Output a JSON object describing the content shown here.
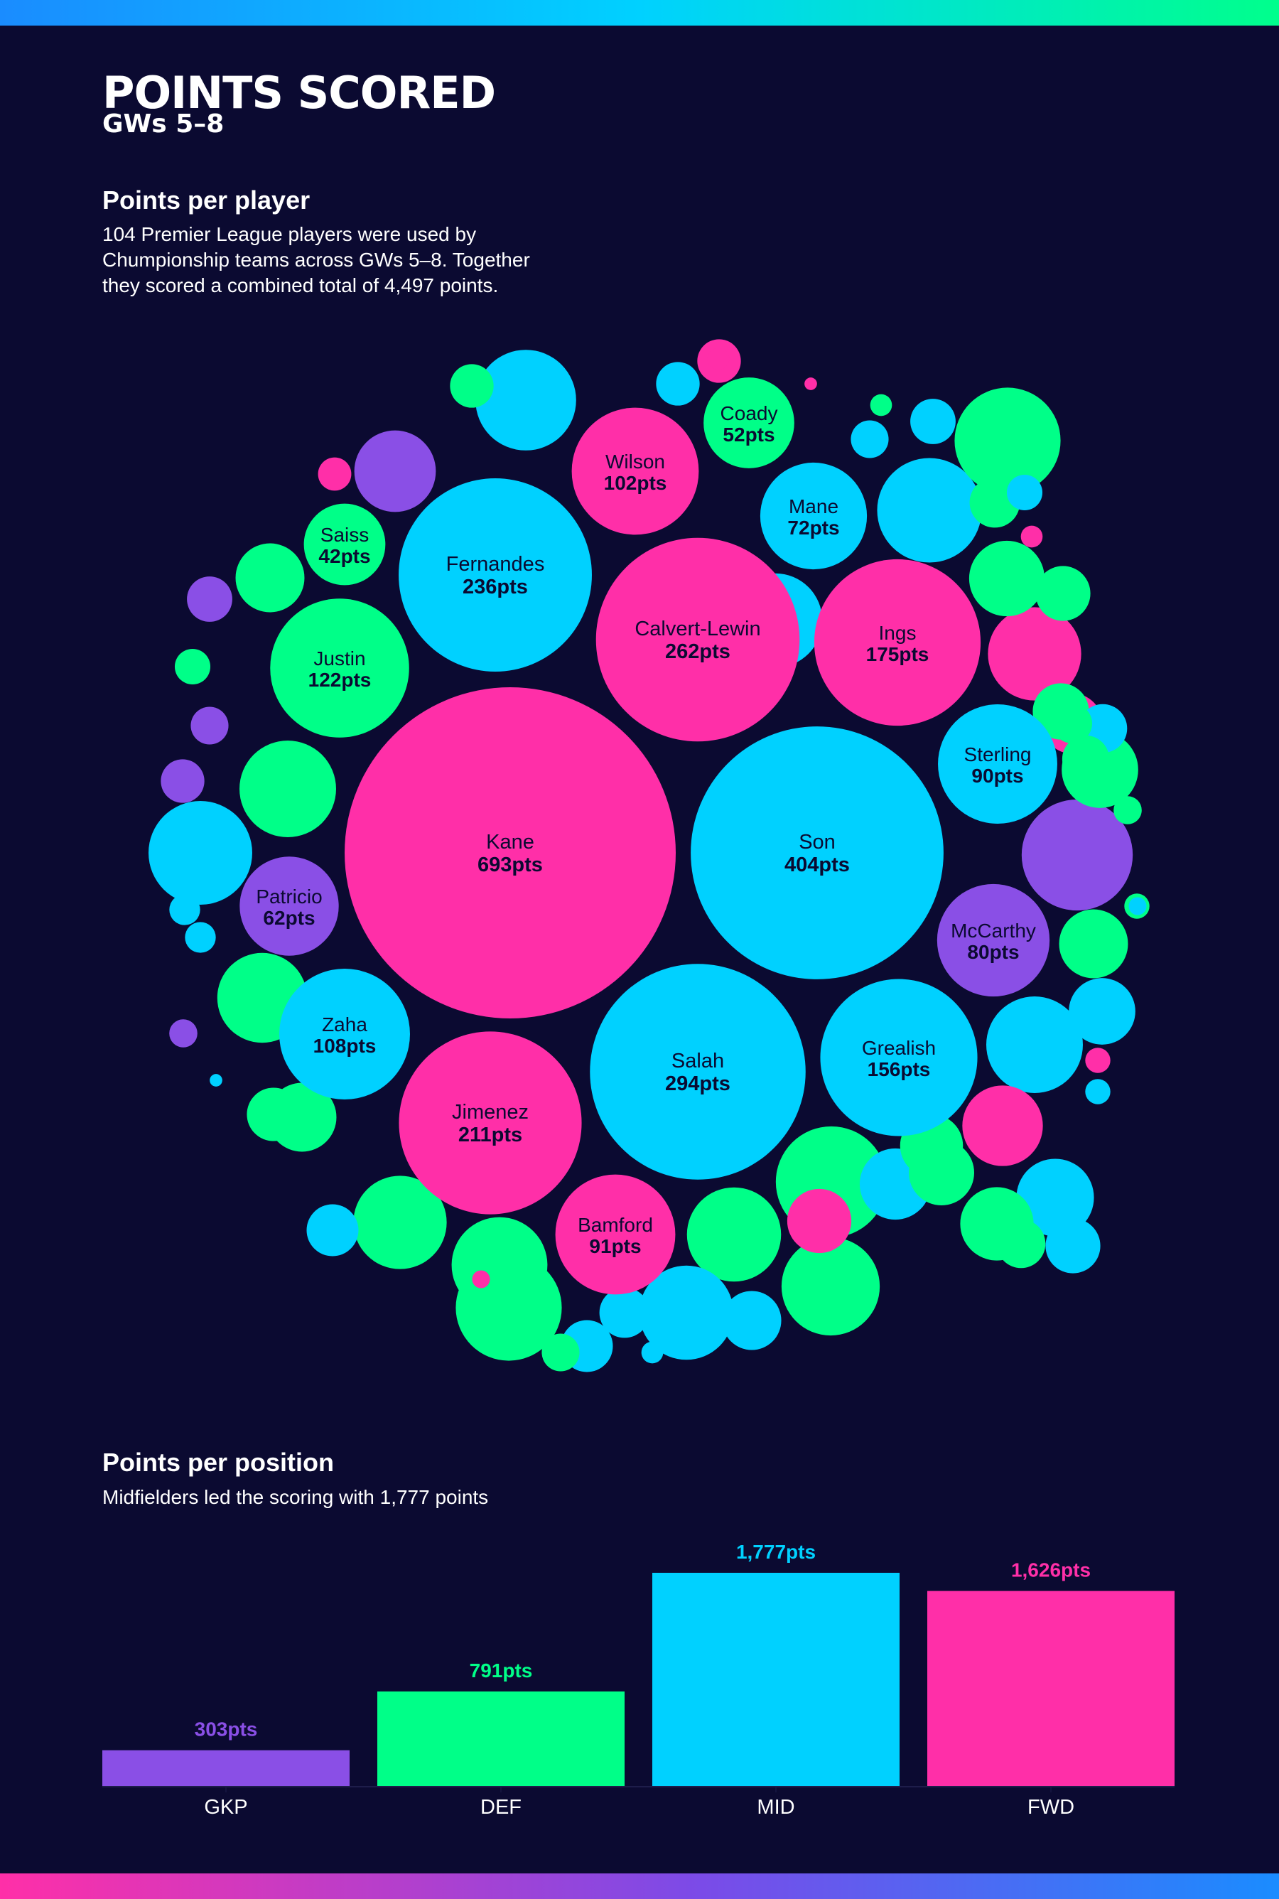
{
  "header": {
    "title": "POINTS SCORED",
    "subtitle": "GWs 5–8"
  },
  "players_section": {
    "heading": "Points per player",
    "description": "104 Premier League players were used by Chumpionship teams across GWs 5–8. Together they scored a combined total of 4,497 points."
  },
  "position_section": {
    "heading": "Points per position",
    "description": "Midfielders led the scoring with 1,777 points"
  },
  "colors": {
    "background": "#0b0a31",
    "GKP": "#8a4fe6",
    "DEF": "#00ff88",
    "MID": "#00d1ff",
    "FWD": "#ff2fa8",
    "bubble_text": "#0b0a31"
  },
  "chart_data": [
    {
      "type": "bubble",
      "title": "Points per player",
      "labeled_players": [
        {
          "name": "Kane",
          "points": 693,
          "label": "693pts",
          "position": "FWD"
        },
        {
          "name": "Son",
          "points": 404,
          "label": "404pts",
          "position": "MID"
        },
        {
          "name": "Salah",
          "points": 294,
          "label": "294pts",
          "position": "MID"
        },
        {
          "name": "Calvert-Lewin",
          "points": 262,
          "label": "262pts",
          "position": "FWD"
        },
        {
          "name": "Fernandes",
          "points": 236,
          "label": "236pts",
          "position": "MID"
        },
        {
          "name": "Jimenez",
          "points": 211,
          "label": "211pts",
          "position": "FWD"
        },
        {
          "name": "Ings",
          "points": 175,
          "label": "175pts",
          "position": "FWD"
        },
        {
          "name": "Grealish",
          "points": 156,
          "label": "156pts",
          "position": "MID"
        },
        {
          "name": "Justin",
          "points": 122,
          "label": "122pts",
          "position": "DEF"
        },
        {
          "name": "Zaha",
          "points": 108,
          "label": "108pts",
          "position": "MID"
        },
        {
          "name": "Wilson",
          "points": 102,
          "label": "102pts",
          "position": "FWD"
        },
        {
          "name": "Bamford",
          "points": 91,
          "label": "91pts",
          "position": "FWD"
        },
        {
          "name": "Sterling",
          "points": 90,
          "label": "90pts",
          "position": "MID"
        },
        {
          "name": "McCarthy",
          "points": 80,
          "label": "80pts",
          "position": "GKP"
        },
        {
          "name": "Mane",
          "points": 72,
          "label": "72pts",
          "position": "MID"
        },
        {
          "name": "Patricio",
          "points": 62,
          "label": "62pts",
          "position": "GKP"
        },
        {
          "name": "Coady",
          "points": 52,
          "label": "52pts",
          "position": "DEF"
        },
        {
          "name": "Saiss",
          "points": 42,
          "label": "42pts",
          "position": "DEF"
        }
      ],
      "unlabeled_players": [
        {
          "position": "MID",
          "points": 64
        },
        {
          "position": "DEF",
          "points": 78
        },
        {
          "position": "GKP",
          "points": 78
        },
        {
          "position": "MID",
          "points": 69
        },
        {
          "position": "FWD",
          "points": 55
        },
        {
          "position": "DEF",
          "points": 59
        },
        {
          "position": "DEF",
          "points": 56
        },
        {
          "position": "MID",
          "points": 56
        },
        {
          "position": "MID",
          "points": 68
        },
        {
          "position": "DEF",
          "points": 61
        },
        {
          "position": "DEF",
          "points": 58
        },
        {
          "position": "MID",
          "points": 59
        },
        {
          "position": "DEF",
          "points": 71
        },
        {
          "position": "MID",
          "points": 56
        },
        {
          "position": "FWD",
          "points": 41
        },
        {
          "position": "DEF",
          "points": 51
        },
        {
          "position": "DEF",
          "points": 55
        },
        {
          "position": "DEF",
          "points": 71
        },
        {
          "position": "GKP",
          "points": 42
        },
        {
          "position": "MID",
          "points": 38
        },
        {
          "position": "DEF",
          "points": 30
        },
        {
          "position": "DEF",
          "points": 37
        },
        {
          "position": "DEF",
          "points": 36
        },
        {
          "position": "DEF",
          "points": 34
        },
        {
          "position": "MID",
          "points": 32
        },
        {
          "position": "DEF",
          "points": 30
        },
        {
          "position": "MID",
          "points": 28
        },
        {
          "position": "DEF",
          "points": 25
        },
        {
          "position": "DEF",
          "points": 27
        },
        {
          "position": "FWD",
          "points": 26
        },
        {
          "position": "DEF",
          "points": 30
        },
        {
          "position": "MID",
          "points": 22
        },
        {
          "position": "FWD",
          "points": 23
        },
        {
          "position": "DEF",
          "points": 19
        },
        {
          "position": "MID",
          "points": 19
        },
        {
          "position": "MID",
          "points": 17
        },
        {
          "position": "DEF",
          "points": 16
        },
        {
          "position": "DEF",
          "points": 20
        },
        {
          "position": "DEF",
          "points": 18
        },
        {
          "position": "MID",
          "points": 17
        },
        {
          "position": "DEF",
          "points": 15
        },
        {
          "position": "MID",
          "points": 16
        },
        {
          "position": "MID",
          "points": 15
        },
        {
          "position": "DEF",
          "points": 14
        },
        {
          "position": "GKP",
          "points": 13
        },
        {
          "position": "MID",
          "points": 13
        },
        {
          "position": "GKP",
          "points": 12
        },
        {
          "position": "MID",
          "points": 12
        },
        {
          "position": "DEF",
          "points": 12
        },
        {
          "position": "FWD",
          "points": 12
        },
        {
          "position": "DEF",
          "points": 10
        },
        {
          "position": "MID",
          "points": 9
        },
        {
          "position": "DEF",
          "points": 9
        },
        {
          "position": "DEF",
          "points": 8
        },
        {
          "position": "GKP",
          "points": 9
        },
        {
          "position": "MID",
          "points": 8
        },
        {
          "position": "DEF",
          "points": 8
        },
        {
          "position": "FWD",
          "points": 7
        },
        {
          "position": "MID",
          "points": 6
        },
        {
          "position": "MID",
          "points": 6
        },
        {
          "position": "GKP",
          "points": 5
        },
        {
          "position": "DEF",
          "points": 5
        },
        {
          "position": "DEF",
          "points": 4
        },
        {
          "position": "FWD",
          "points": 4
        },
        {
          "position": "MID",
          "points": 4
        },
        {
          "position": "FWD",
          "points": 3
        },
        {
          "position": "DEF",
          "points": 3
        },
        {
          "position": "FWD",
          "points": 3
        },
        {
          "position": "MID",
          "points": 3
        },
        {
          "position": "DEF",
          "points": 2
        },
        {
          "position": "MID",
          "points": 2
        },
        {
          "position": "DEF",
          "points": 2
        },
        {
          "position": "FWD",
          "points": 2
        },
        {
          "position": "DEF",
          "points": 1
        },
        {
          "position": "FWD",
          "points": 1
        },
        {
          "position": "MID",
          "points": 1
        }
      ]
    },
    {
      "type": "bar",
      "title": "Points per position",
      "categories": [
        "GKP",
        "DEF",
        "MID",
        "FWD"
      ],
      "values": [
        303,
        791,
        1777,
        1626
      ],
      "value_labels": [
        "303pts",
        "791pts",
        "1,777pts",
        "1,626pts"
      ],
      "ylim": [
        0,
        1777
      ],
      "grid": false
    }
  ]
}
